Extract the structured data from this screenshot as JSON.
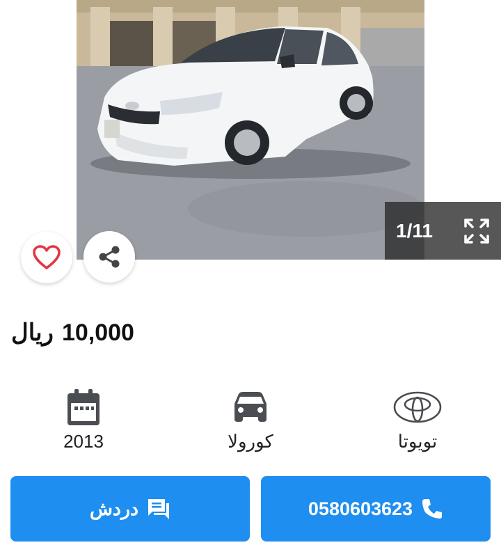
{
  "gallery": {
    "counter": "1/11",
    "icons": {
      "prev": "chevron-left-icon",
      "next": "chevron-right-icon",
      "fullscreen": "fullscreen-icon",
      "favorite": "heart-icon",
      "share": "share-icon"
    }
  },
  "listing": {
    "price": "10,000",
    "currency": "ريال"
  },
  "specs": {
    "year": "2013",
    "model": "كورولا",
    "make": "تويوتا"
  },
  "actions": {
    "chat_label": "دردش",
    "phone_number": "0580603623"
  },
  "colors": {
    "primary": "#1e8ef0",
    "heart": "#e23744",
    "icon_gray": "#444444"
  }
}
